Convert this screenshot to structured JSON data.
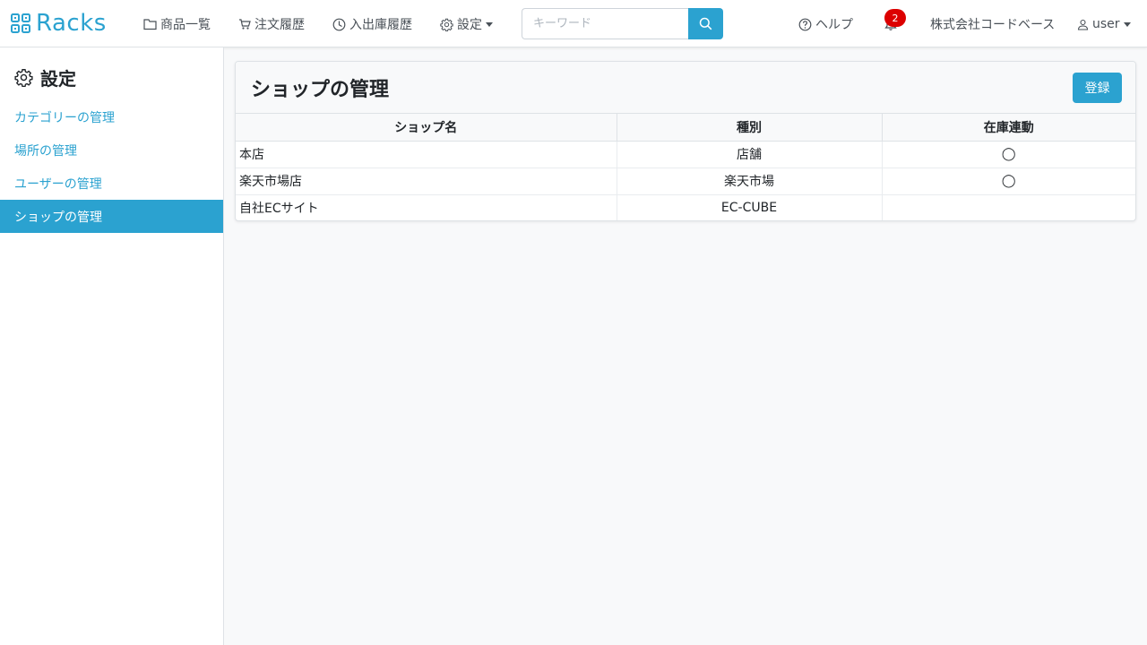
{
  "navbar": {
    "brand": "Racks",
    "items": [
      {
        "label": "商品一覧"
      },
      {
        "label": "注文履歴"
      },
      {
        "label": "入出庫履歴"
      },
      {
        "label": "設定"
      }
    ],
    "search_placeholder": "キーワード",
    "help_label": "ヘルプ",
    "notification_count": "2",
    "company_label": "株式会社コードベース",
    "user_label": "user"
  },
  "sidebar": {
    "title": "設定",
    "items": [
      {
        "label": "カテゴリーの管理"
      },
      {
        "label": "場所の管理"
      },
      {
        "label": "ユーザーの管理"
      },
      {
        "label": "ショップの管理"
      }
    ]
  },
  "main": {
    "title": "ショップの管理",
    "register_label": "登録",
    "columns": [
      "ショップ名",
      "種別",
      "在庫連動"
    ],
    "rows": [
      {
        "name": "本店",
        "type": "店舗",
        "sync": "◯"
      },
      {
        "name": "楽天市場店",
        "type": "楽天市場",
        "sync": "◯"
      },
      {
        "name": "自社ECサイト",
        "type": "EC-CUBE",
        "sync": ""
      }
    ]
  },
  "colors": {
    "accent": "#2ba2d0",
    "badge": "#dc0000"
  }
}
